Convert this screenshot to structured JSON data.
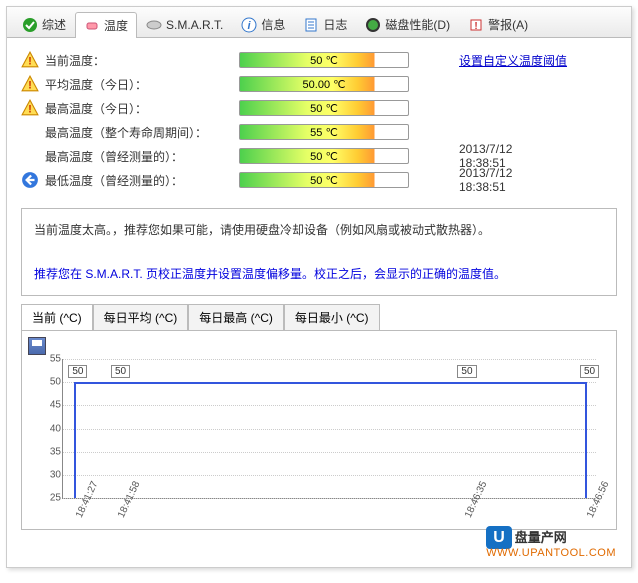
{
  "tabs": [
    {
      "label": "综述"
    },
    {
      "label": "温度"
    },
    {
      "label": "S.M.A.R.T."
    },
    {
      "label": "信息"
    },
    {
      "label": "日志"
    },
    {
      "label": "磁盘性能(D)"
    },
    {
      "label": "警报(A)"
    }
  ],
  "rows": [
    {
      "icon": "warn",
      "label": "当前温度：",
      "value": "50 ℃",
      "link": "设置自定义温度阈值"
    },
    {
      "icon": "warn",
      "label": "平均温度（今日）：",
      "value": "50.00 ℃"
    },
    {
      "icon": "warn",
      "label": "最高温度（今日）：",
      "value": "50 ℃"
    },
    {
      "icon": "none",
      "label": "最高温度（整个寿命周期间）：",
      "value": "55 ℃"
    },
    {
      "icon": "none",
      "label": "最高温度（曾经测量的）：",
      "value": "50 ℃",
      "extra": "2013/7/12 18:38:51"
    },
    {
      "icon": "back",
      "label": "最低温度（曾经测量的）：",
      "value": "50 ℃",
      "extra": "2013/7/12 18:38:51"
    }
  ],
  "message": {
    "line1": "当前温度太高。，推荐您如果可能，请使用硬盘冷却设备（例如风扇或被动式散热器）。",
    "line2": "推荐您在 S.M.A.R.T. 页校正温度并设置温度偏移量。校正之后，会显示的正确的温度值。"
  },
  "chart_tabs": [
    {
      "label": "当前 (^C)"
    },
    {
      "label": "每日平均 (^C)"
    },
    {
      "label": "每日最高 (^C)"
    },
    {
      "label": "每日最小 (^C)"
    }
  ],
  "chart_data": {
    "type": "line",
    "ylabel": "",
    "xlabel": "",
    "ylim": [
      25,
      55
    ],
    "yticks": [
      25,
      30,
      35,
      40,
      45,
      50,
      55
    ],
    "categories": [
      "18:41:27",
      "18:41:58",
      "18:46:35",
      "18:46:56"
    ],
    "values": [
      50,
      50,
      50,
      50
    ],
    "point_labels": [
      "50",
      "50",
      "50",
      "50"
    ]
  },
  "footer": {
    "brand": "盘量产网",
    "url": "WWW.UPANTOOL.COM"
  }
}
